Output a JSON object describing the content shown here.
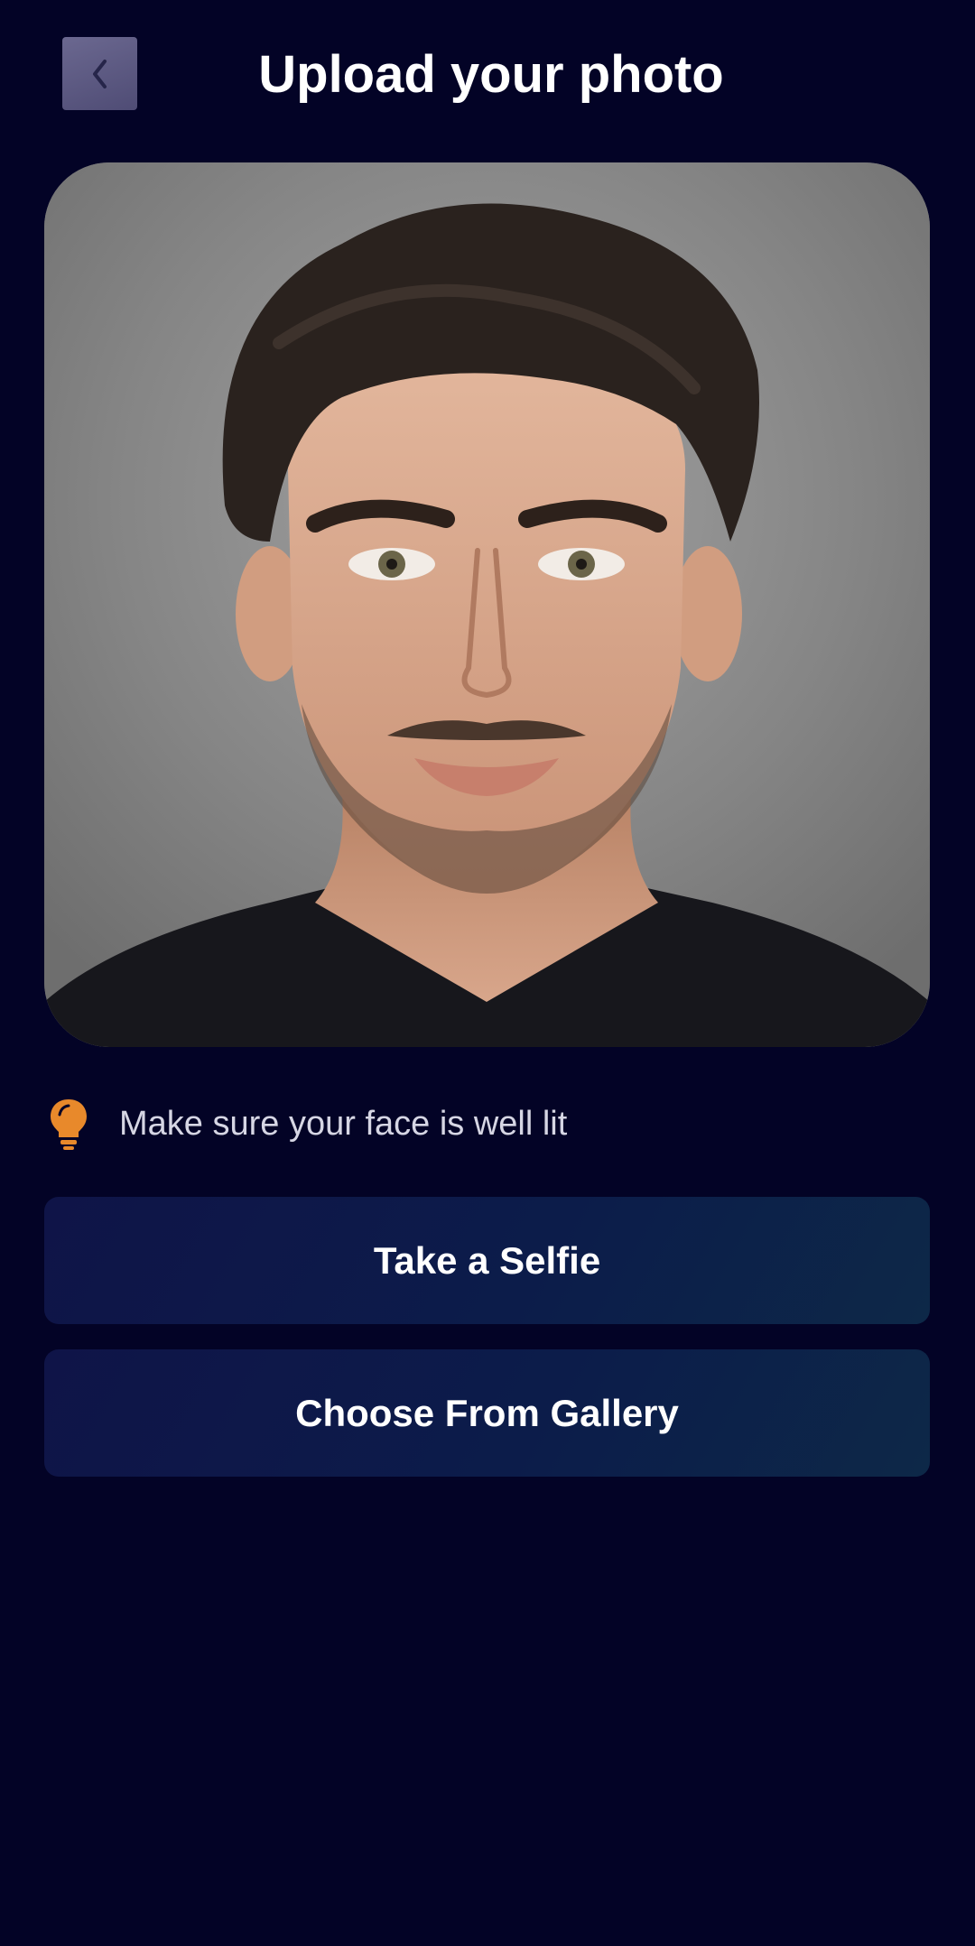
{
  "header": {
    "title": "Upload your photo",
    "back_icon": "chevron-left-icon"
  },
  "photo": {
    "description_icon": "portrait-photo"
  },
  "tip": {
    "icon": "lightbulb-icon",
    "icon_color": "#e8892b",
    "text": "Make sure your face is well lit"
  },
  "actions": {
    "selfie_label": "Take a Selfie",
    "gallery_label": "Choose From Gallery"
  },
  "colors": {
    "background": "#030326",
    "button_gradient_start": "#0f1448",
    "button_gradient_end": "#0d2848"
  }
}
